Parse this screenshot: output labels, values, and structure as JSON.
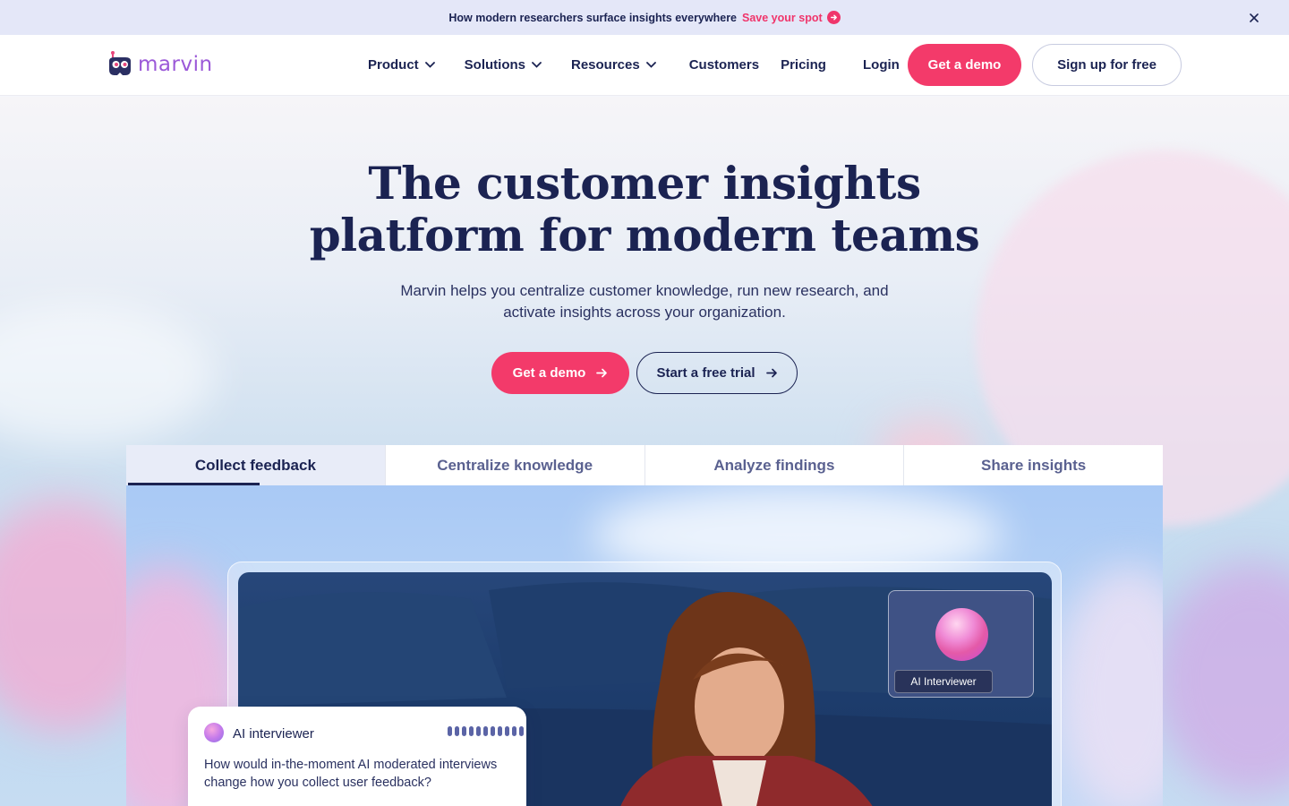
{
  "announcement": {
    "text": "How modern researchers surface insights everywhere",
    "cta": "Save your spot",
    "icons": {
      "cta": "arrow-right-circle-icon",
      "close": "close-icon"
    }
  },
  "nav": {
    "logo_text": "marvin",
    "menu": [
      {
        "label": "Product",
        "has_dropdown": true
      },
      {
        "label": "Solutions",
        "has_dropdown": true
      },
      {
        "label": "Resources",
        "has_dropdown": true
      },
      {
        "label": "Customers",
        "has_dropdown": false
      },
      {
        "label": "Pricing",
        "has_dropdown": false
      }
    ],
    "login": "Login",
    "demo_button": "Get a demo",
    "signup_button": "Sign up for free"
  },
  "hero": {
    "title_line1": "The customer insights",
    "title_line2": "platform for modern teams",
    "subtitle": "Marvin helps you centralize customer knowledge, run new research, and activate insights across your organization.",
    "primary_cta": "Get a demo",
    "secondary_cta": "Start a free trial"
  },
  "tabs": [
    {
      "label": "Collect feedback",
      "active": true
    },
    {
      "label": "Centralize knowledge",
      "active": false
    },
    {
      "label": "Analyze findings",
      "active": false
    },
    {
      "label": "Share insights",
      "active": false
    }
  ],
  "showcase": {
    "ai_card_label": "AI Interviewer",
    "chat": {
      "title": "AI interviewer",
      "message": "How would in-the-moment AI moderated interviews change how you collect user feedback?"
    }
  },
  "colors": {
    "accent": "#f33a6a",
    "navy": "#1b2352",
    "announcement_bg": "#e4e7f8",
    "logo": "#9b59d8"
  }
}
